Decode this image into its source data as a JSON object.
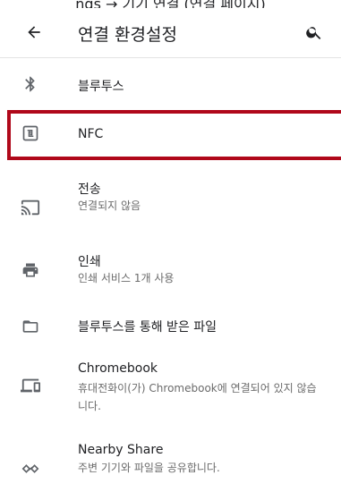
{
  "caption": "ngs → 기기 연결 (연결 페이지)",
  "appbar": {
    "title": "연결 환경설정",
    "back_icon": "arrow-back-icon",
    "search_icon": "search-icon"
  },
  "items": [
    {
      "name": "bluetooth",
      "icon": "bluetooth-icon",
      "label": "블루투스",
      "sub": ""
    },
    {
      "name": "nfc",
      "icon": "nfc-icon",
      "label": "NFC",
      "sub": ""
    },
    {
      "name": "cast",
      "icon": "cast-icon",
      "label": "전송",
      "sub": "연결되지 않음"
    },
    {
      "name": "print",
      "icon": "print-icon",
      "label": "인쇄",
      "sub": "인쇄 서비스 1개 사용"
    },
    {
      "name": "bt-files",
      "icon": "folder-icon",
      "label": "블루투스를 통해 받은 파일",
      "sub": ""
    },
    {
      "name": "chromebook",
      "icon": "devices-icon",
      "label": "Chromebook",
      "sub": "휴대전화이(가) Chromebook에 연결되어 있지 않습니다."
    },
    {
      "name": "nearby-share",
      "icon": "nearby-share-icon",
      "label": "Nearby Share",
      "sub": "주변 기기와 파일을 공유합니다."
    }
  ],
  "colors": {
    "highlight": "#b0081a",
    "icon": "#5f6368",
    "text": "#202124",
    "subtext": "#6b6b6b"
  }
}
